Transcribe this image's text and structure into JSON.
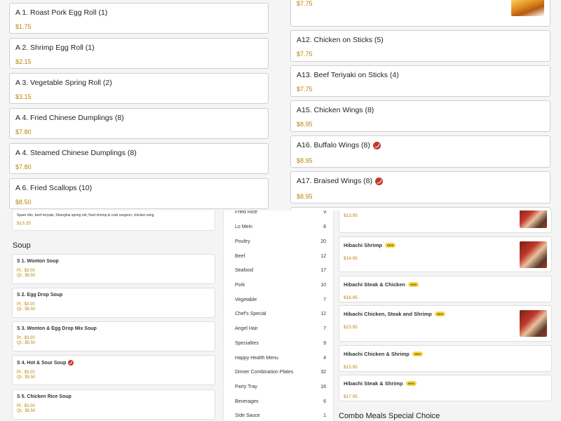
{
  "combo_card": {
    "description": "Spare ribs, beef teriyaki, Shanghai spring roll, fried shrimp & crab rangoon, chicken wing",
    "price": "$13.25"
  },
  "soup": {
    "heading": "Soup",
    "items": [
      {
        "name": "S 1. Wonton Soup",
        "pt": "Pt.: $3.00",
        "qt": "Qt.: $5.50",
        "spicy": false
      },
      {
        "name": "S 2. Egg Drop Soup",
        "pt": "Pt.: $3.00",
        "qt": "Qt.: $5.50",
        "spicy": false
      },
      {
        "name": "S 3. Wonton & Egg Drop Mix Soup",
        "pt": "Pt.: $3.00",
        "qt": "Qt.: $5.50",
        "spicy": false
      },
      {
        "name": "S 4. Hot & Sour Soup",
        "pt": "Pt.: $3.00",
        "qt": "Qt.: $5.50",
        "spicy": true
      },
      {
        "name": "S 5. Chicken Rice Soup",
        "pt": "Pt.: $3.00",
        "qt": "Qt.: $5.50",
        "spicy": false
      }
    ]
  },
  "categories": [
    {
      "name": "Fried Rice",
      "count": "9"
    },
    {
      "name": "Lo Mein",
      "count": "8"
    },
    {
      "name": "Poultry",
      "count": "20"
    },
    {
      "name": "Beef",
      "count": "12"
    },
    {
      "name": "Seafood",
      "count": "17"
    },
    {
      "name": "Pork",
      "count": "10"
    },
    {
      "name": "Vegetable",
      "count": "7"
    },
    {
      "name": "Chef's Special",
      "count": "12"
    },
    {
      "name": "Angel Hair",
      "count": "7"
    },
    {
      "name": "Specialties",
      "count": "9"
    },
    {
      "name": "Happy Health Menu",
      "count": "4"
    },
    {
      "name": "Dinner Combination Plates",
      "count": "32"
    },
    {
      "name": "Party Tray",
      "count": "16"
    },
    {
      "name": "Beverages",
      "count": "6"
    },
    {
      "name": "Side Sauce",
      "count": "1"
    }
  ],
  "hibachi": {
    "top_price": "$13.95",
    "items": [
      {
        "name": "Hibachi Shrimp",
        "price": "$14.95",
        "badge": "NEW",
        "has_image": true
      },
      {
        "name": "Hibachi Steak & Chicken",
        "price": "$16.95",
        "badge": "NEW",
        "has_image": false
      },
      {
        "name": "Hibachi Chicken, Steak and Shrimp",
        "price": "$23.95",
        "badge": "NEW",
        "has_image": true
      },
      {
        "name": "Hibachi Chicken & Shrimp",
        "price": "$15.95",
        "badge": "NEW",
        "has_image": false
      },
      {
        "name": "Hibachi Steak & Shrimp",
        "price": "$17.95",
        "badge": "NEW",
        "has_image": false
      }
    ],
    "next_heading": "Combo Meals Special Choice"
  },
  "popup_left": [
    {
      "name": "A 1. Roast Pork Egg Roll (1)",
      "price": "$1.75",
      "spicy": false
    },
    {
      "name": "A 2. Shrimp Egg Roll (1)",
      "price": "$2.15",
      "spicy": false
    },
    {
      "name": "A 3. Vegetable Spring Roll (2)",
      "price": "$3.15",
      "spicy": false
    },
    {
      "name": "A 4. Fried Chinese Dumplings (8)",
      "price": "$7.80",
      "spicy": false
    },
    {
      "name": "A 4. Steamed Chinese Dumplings (8)",
      "price": "$7.80",
      "spicy": false
    },
    {
      "name": "A 6. Fried Scallops (10)",
      "price": "$8.50",
      "spicy": false
    }
  ],
  "popup_right": {
    "top_price": "$7.75",
    "items": [
      {
        "name": "A12. Chicken on Sticks (5)",
        "price": "$7.75",
        "spicy": false
      },
      {
        "name": "A13. Beef Teriyaki on Sticks (4)",
        "price": "$7.75",
        "spicy": false
      },
      {
        "name": "A15. Chicken Wings (8)",
        "price": "$8.95",
        "spicy": false
      },
      {
        "name": "A16. Buffalo Wings (8)",
        "price": "$8.95",
        "spicy": true
      },
      {
        "name": "A17. Braised Wings (8)",
        "price": "$8.95",
        "spicy": true
      }
    ]
  }
}
